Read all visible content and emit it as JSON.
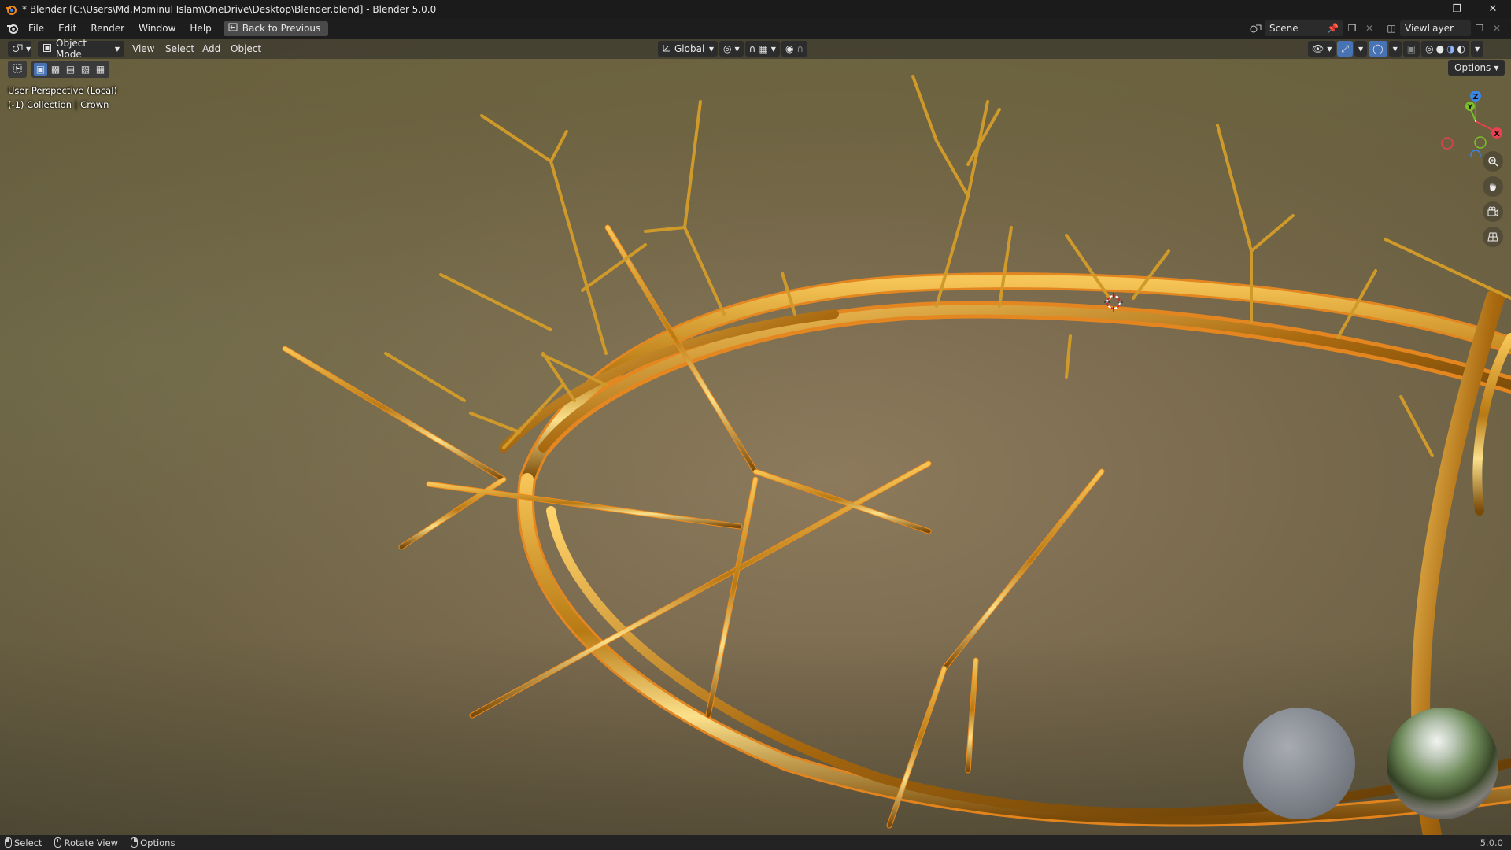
{
  "window": {
    "title": "* Blender [C:\\Users\\Md.Mominul Islam\\OneDrive\\Desktop\\Blender.blend] - Blender 5.0.0",
    "controls": [
      "minimize-icon",
      "restore-icon",
      "close-icon"
    ]
  },
  "menu": {
    "items": [
      "File",
      "Edit",
      "Render",
      "Window",
      "Help"
    ],
    "back_button": "Back to Previous"
  },
  "scene": {
    "name": "Scene",
    "view_layer": "ViewLayer"
  },
  "viewport_header": {
    "mode": "Object Mode",
    "menus": [
      "View",
      "Select",
      "Add",
      "Object"
    ],
    "transform_orientation": "Global",
    "options_label": "Options"
  },
  "viewport_overlay": {
    "perspective": "User Perspective (Local)",
    "collection": "(-1) Collection | Crown"
  },
  "gizmo": {
    "axes": [
      "X",
      "Y",
      "Z"
    ],
    "colors": {
      "x": "#e8414f",
      "y": "#7bbf29",
      "z": "#3b86e0"
    }
  },
  "statusbar": {
    "hints": [
      "Select",
      "Rotate View",
      "Options"
    ],
    "version": "5.0.0"
  },
  "colors": {
    "gold": "#d09a2a",
    "selection_outline": "#f08a1c",
    "header_bg": "#1d1d1d"
  }
}
